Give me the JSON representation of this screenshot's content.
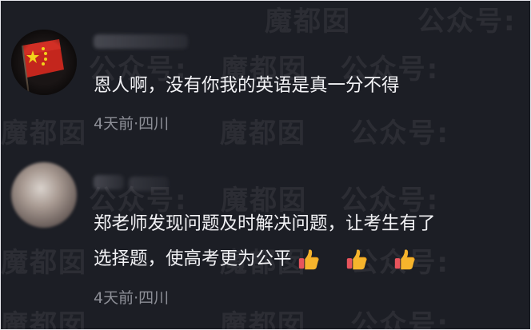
{
  "watermark": {
    "text_a": "魔都囡",
    "text_b": "公众号:"
  },
  "comments": [
    {
      "text": "恩人啊，没有你我的英语是真一分不得",
      "meta": "4天前·四川",
      "avatar": "flag-avatar"
    },
    {
      "text_line1": "郑老师发现问题及时解决问题，让考生有了",
      "text_line2": "选择题，使高考更为公平",
      "meta": "4天前·四川",
      "reactions": [
        "thumbs-up-icon",
        "thumbs-up-icon",
        "thumbs-up-icon"
      ],
      "avatar": "blurred-avatar"
    }
  ],
  "colors": {
    "background": "#1c1e25",
    "text": "#f2f2f5",
    "meta": "#8d8f97",
    "thumb": "#f6b42c"
  }
}
